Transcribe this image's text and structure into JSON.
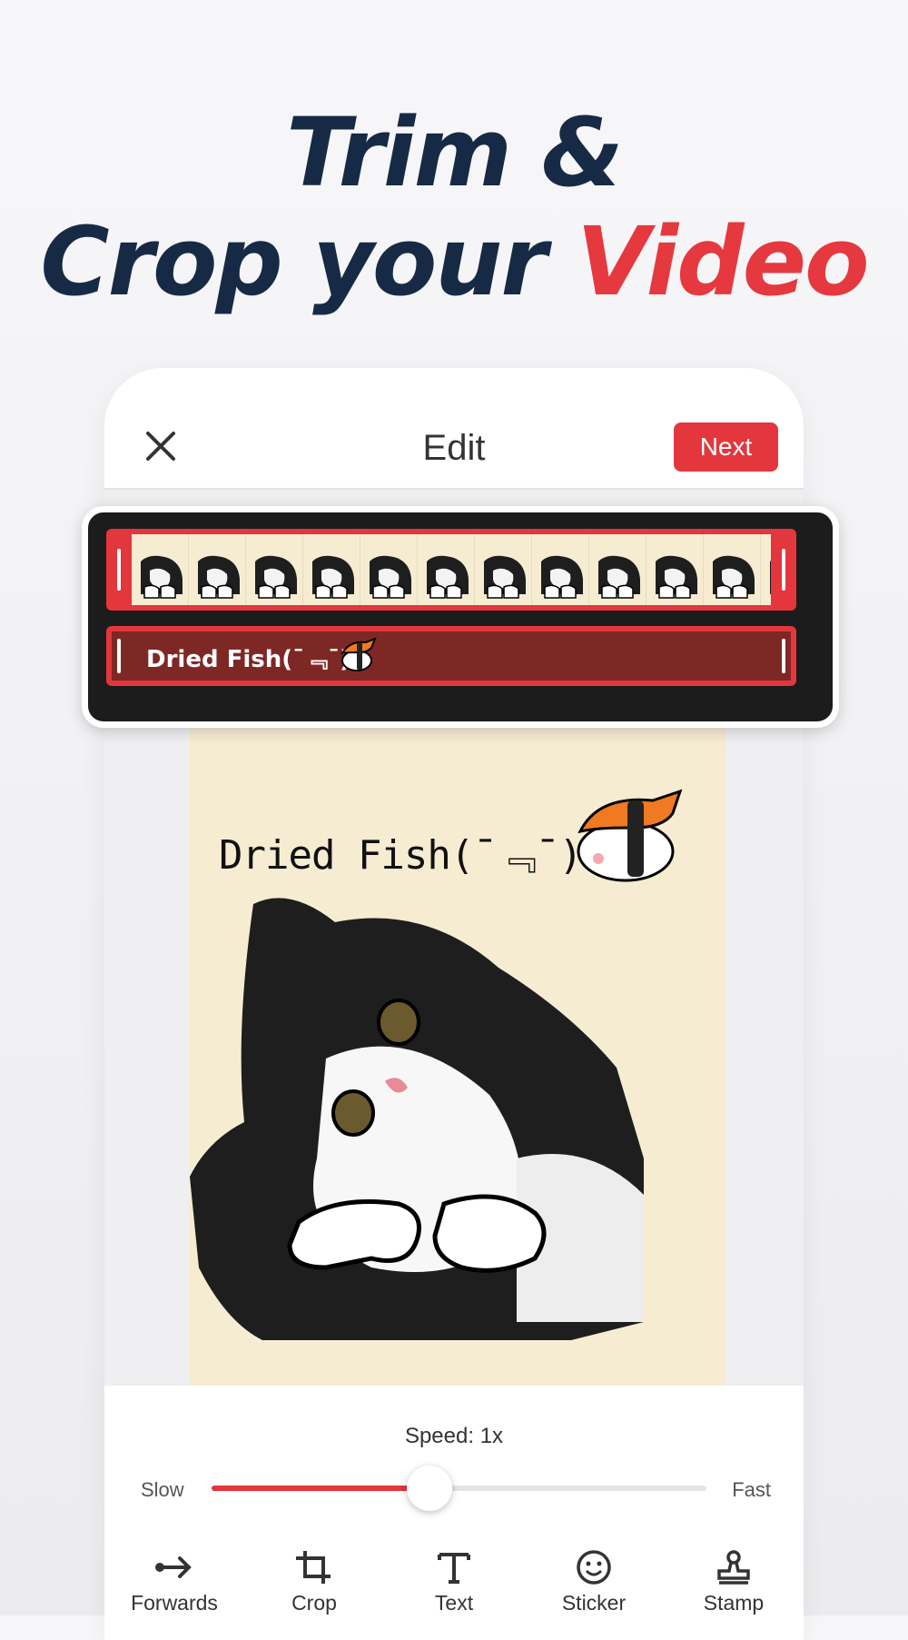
{
  "headline": {
    "line1": "Trim &",
    "line2_prefix": "Crop your",
    "line2_accent": "Video"
  },
  "topbar": {
    "title": "Edit",
    "next_label": "Next"
  },
  "timeline": {
    "text_track_label": "Dried Fish(¯﹃¯)"
  },
  "canvas": {
    "caption": "Dried Fish(¯﹃¯)"
  },
  "speed": {
    "label": "Speed: 1x",
    "slow_label": "Slow",
    "fast_label": "Fast",
    "value_fraction": 0.44
  },
  "toolbar": {
    "items": [
      {
        "label": "Forwards",
        "icon": "arrow-forward-icon"
      },
      {
        "label": "Crop",
        "icon": "crop-icon"
      },
      {
        "label": "Text",
        "icon": "text-icon"
      },
      {
        "label": "Sticker",
        "icon": "smiley-icon"
      },
      {
        "label": "Stamp",
        "icon": "stamp-icon"
      }
    ]
  },
  "colors": {
    "accent": "#e3363d",
    "headline": "#172a45",
    "canvas_bg": "#f5ecd2"
  }
}
